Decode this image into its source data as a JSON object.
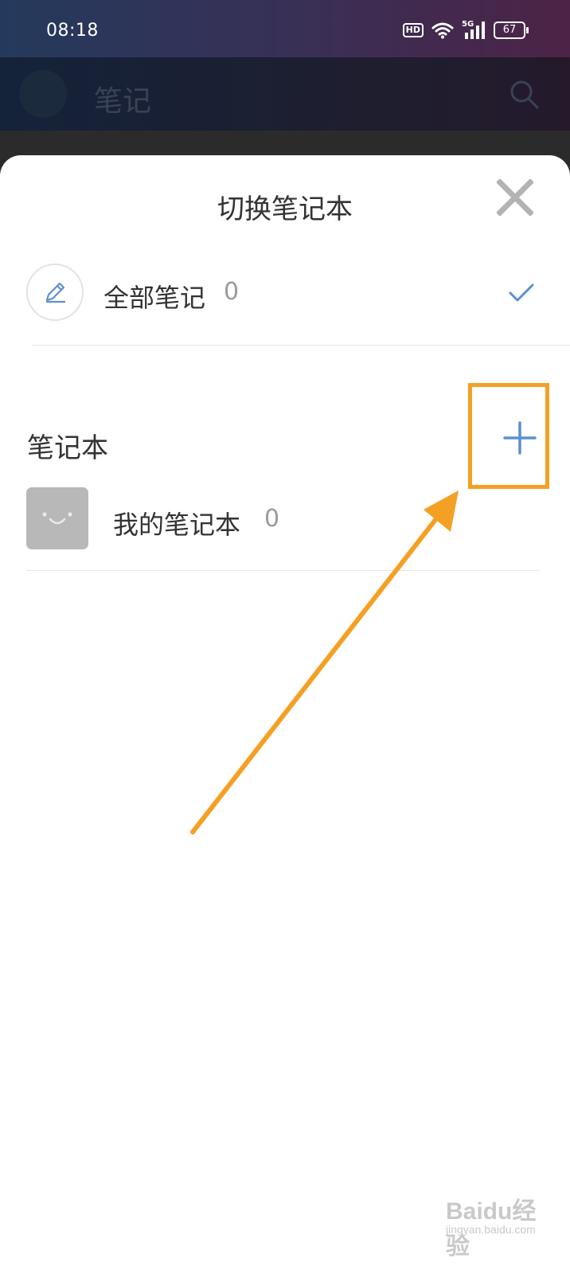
{
  "status_bar": {
    "time": "08:18",
    "hd_badge": "HD",
    "network": "5G",
    "battery": "67"
  },
  "app_header": {
    "title": "笔记",
    "search_icon": "search-icon"
  },
  "sheet": {
    "title": "切换笔记本",
    "close_icon": "close-icon",
    "all_notes": {
      "label": "全部笔记",
      "count": "0",
      "icon": "pencil-icon",
      "selected_icon": "check-icon"
    },
    "section": {
      "label": "笔记本",
      "add_icon": "plus-icon"
    },
    "notebooks": [
      {
        "label": "我的笔记本",
        "count": "0",
        "icon": "smiley-thumbnail"
      }
    ]
  },
  "annotation": {
    "color": "#f4a025"
  },
  "watermark": {
    "text": "Baidu经验",
    "sub": "jingyan.baidu.com"
  },
  "colors": {
    "accent_blue": "#5b8fd0",
    "text_primary": "#333333",
    "text_secondary": "#9b9b9b"
  }
}
